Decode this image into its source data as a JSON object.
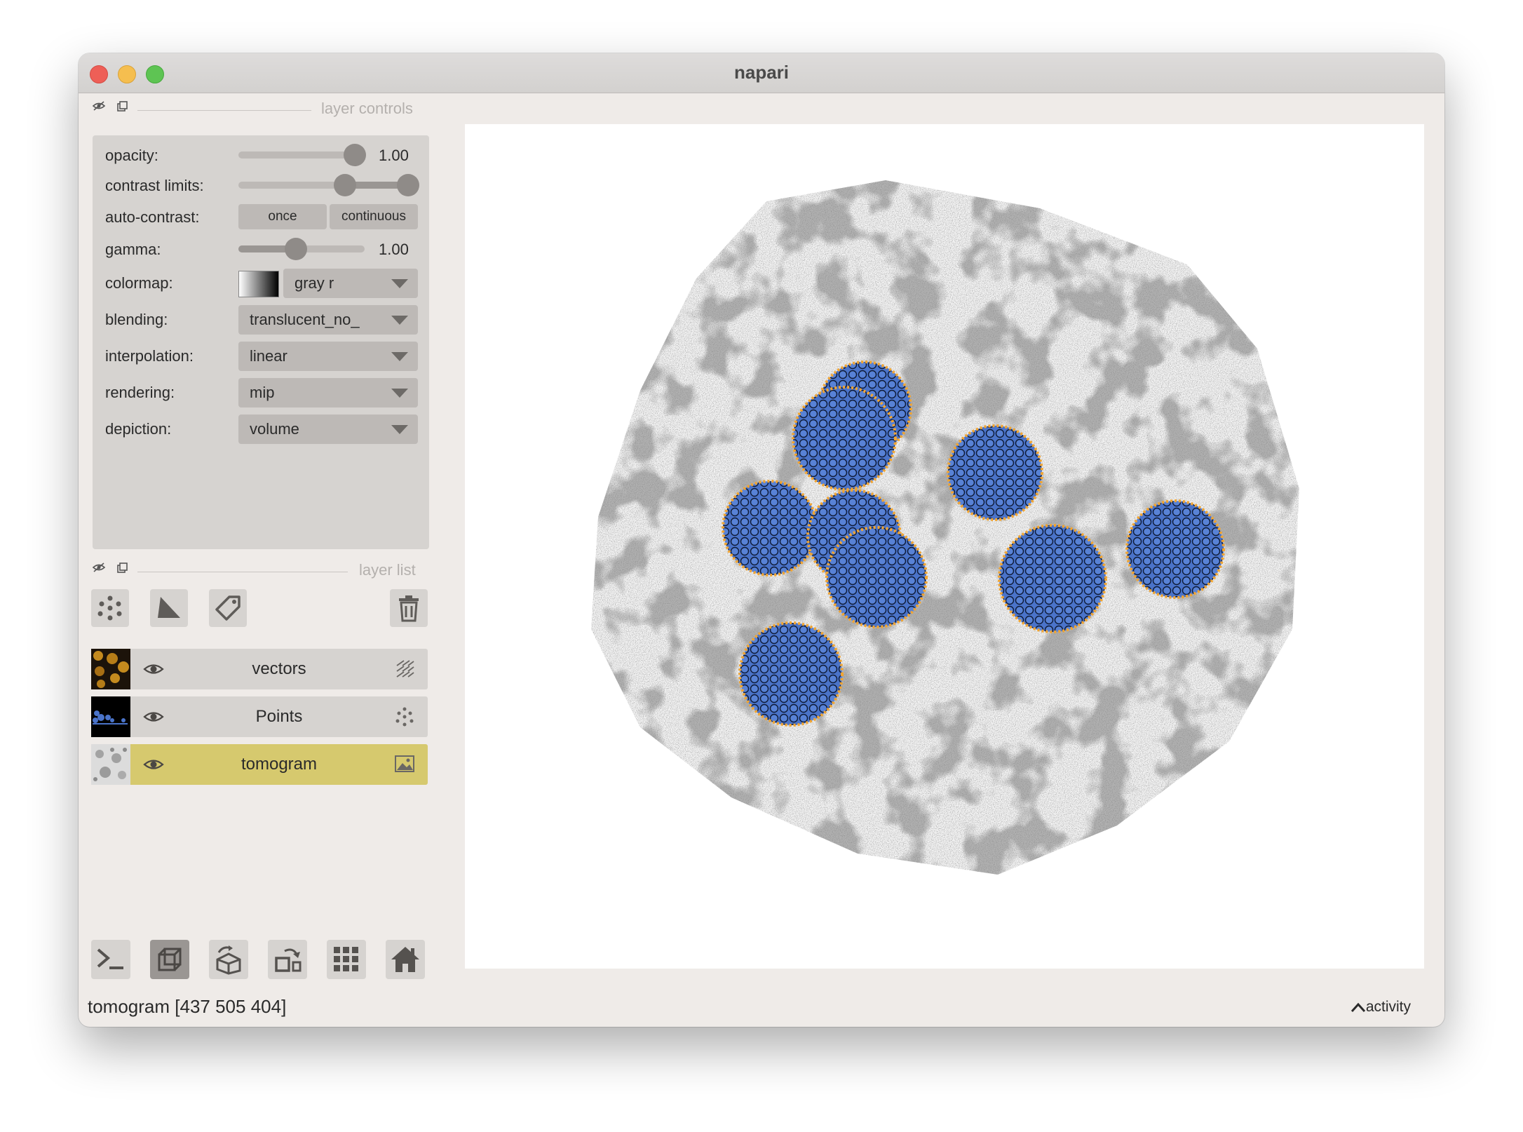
{
  "window": {
    "title": "napari"
  },
  "layer_controls": {
    "header": "layer controls",
    "opacity": {
      "label": "opacity:",
      "value": "1.00",
      "level": 1.0
    },
    "contrast_limits": {
      "label": "contrast limits:",
      "low": 0.55,
      "high": 0.92
    },
    "auto_contrast": {
      "label": "auto-contrast:",
      "once": "once",
      "continuous": "continuous"
    },
    "gamma": {
      "label": "gamma:",
      "value": "1.00",
      "level": 0.45
    },
    "colormap": {
      "label": "colormap:",
      "value": "gray r"
    },
    "blending": {
      "label": "blending:",
      "value": "translucent_no_"
    },
    "interpolation": {
      "label": "interpolation:",
      "value": "linear"
    },
    "rendering": {
      "label": "rendering:",
      "value": "mip"
    },
    "depiction": {
      "label": "depiction:",
      "value": "volume"
    }
  },
  "layer_list": {
    "header": "layer list",
    "layers": [
      {
        "name": "vectors",
        "visible": true,
        "selected": false,
        "type_icon": "vectors-icon"
      },
      {
        "name": "Points",
        "visible": true,
        "selected": false,
        "type_icon": "points-icon"
      },
      {
        "name": "tomogram",
        "visible": true,
        "selected": true,
        "type_icon": "image-icon"
      }
    ]
  },
  "toolbar_icons": [
    "points-layer-icon",
    "shapes-layer-icon",
    "labels-layer-icon",
    "delete-layer-icon"
  ],
  "bottom_icons": [
    "console-icon",
    "ndisplay-icon",
    "roll-dims-icon",
    "transpose-icon",
    "grid-icon",
    "home-icon"
  ],
  "status": {
    "text": "tomogram [437 505 404]",
    "activity": "activity"
  },
  "colors": {
    "selected_layer": "#d6c96e",
    "sphere_fill": "#4a73c9",
    "sphere_outline": "#f2a531",
    "panel": "#d6d3d0",
    "window": "#efebe8"
  }
}
